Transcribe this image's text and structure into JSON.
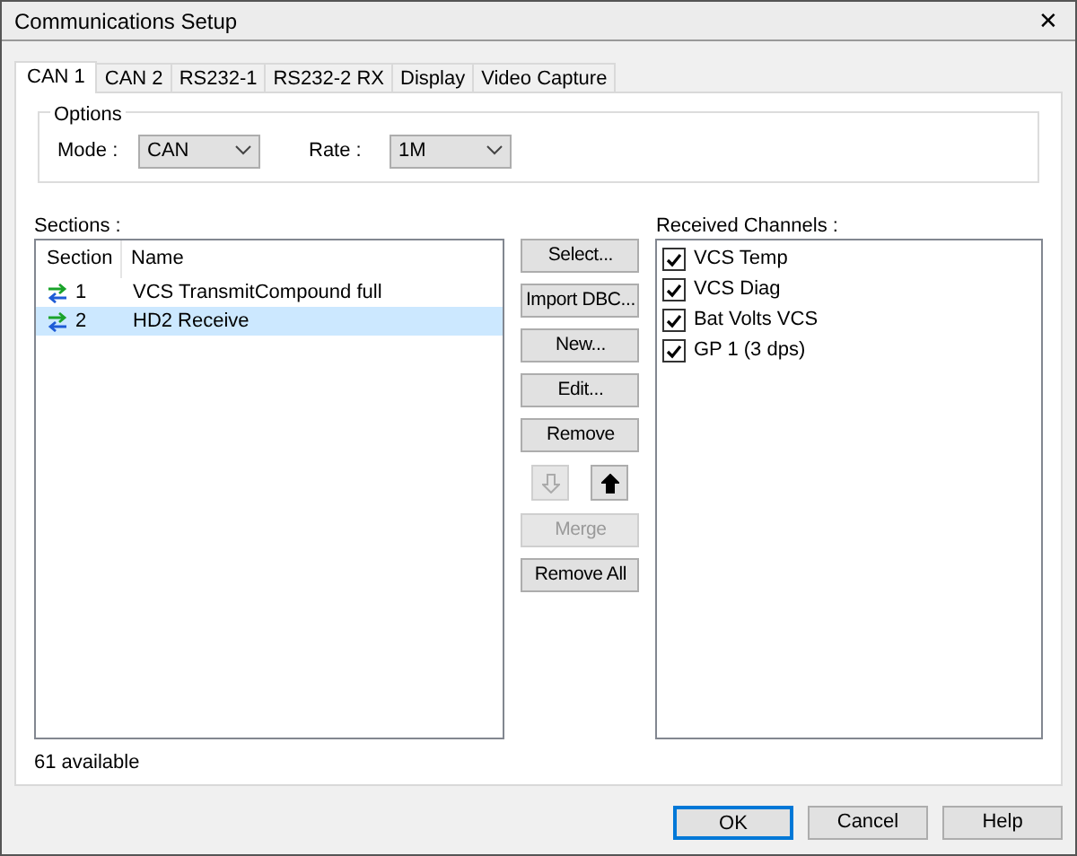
{
  "window": {
    "title": "Communications Setup",
    "close": "✕"
  },
  "tabs": [
    {
      "label": "CAN 1",
      "selected": true
    },
    {
      "label": "CAN 2",
      "selected": false
    },
    {
      "label": "RS232-1",
      "selected": false
    },
    {
      "label": "RS232-2 RX",
      "selected": false
    },
    {
      "label": "Display",
      "selected": false
    },
    {
      "label": "Video Capture",
      "selected": false
    }
  ],
  "options": {
    "title": "Options",
    "mode": {
      "label": "Mode :",
      "value": "CAN"
    },
    "rate": {
      "label": "Rate :",
      "value": "1M"
    }
  },
  "sections": {
    "label": "Sections :",
    "columns": [
      "Section",
      "Name"
    ],
    "rows": [
      {
        "section": "1",
        "name": "VCS TransmitCompound full",
        "selected": false
      },
      {
        "section": "2",
        "name": "HD2 Receive",
        "selected": true
      }
    ],
    "footer": "61 available"
  },
  "actions": [
    {
      "kind": "button",
      "label": "Select...",
      "disabled": false
    },
    {
      "kind": "button",
      "label": "Import DBC...",
      "disabled": false
    },
    {
      "kind": "button",
      "label": "New...",
      "disabled": false
    },
    {
      "kind": "button",
      "label": "Edit...",
      "disabled": false
    },
    {
      "kind": "button",
      "label": "Remove",
      "disabled": false
    },
    {
      "kind": "arrows",
      "items": [
        {
          "kind": "down",
          "disabled": true
        },
        {
          "kind": "up",
          "disabled": false
        }
      ]
    },
    {
      "kind": "button",
      "label": "Merge",
      "disabled": true
    },
    {
      "kind": "button",
      "label": "Remove All",
      "disabled": false
    }
  ],
  "channels": {
    "label": "Received Channels :",
    "items": [
      {
        "name": "VCS Temp",
        "checked": true
      },
      {
        "name": "VCS Diag",
        "checked": true
      },
      {
        "name": "Bat Volts VCS",
        "checked": true
      },
      {
        "name": "GP 1 (3 dps)",
        "checked": true
      }
    ]
  },
  "buttons": [
    {
      "label": "OK",
      "default": true
    },
    {
      "label": "Cancel",
      "default": false
    },
    {
      "label": "Help",
      "default": false
    }
  ]
}
